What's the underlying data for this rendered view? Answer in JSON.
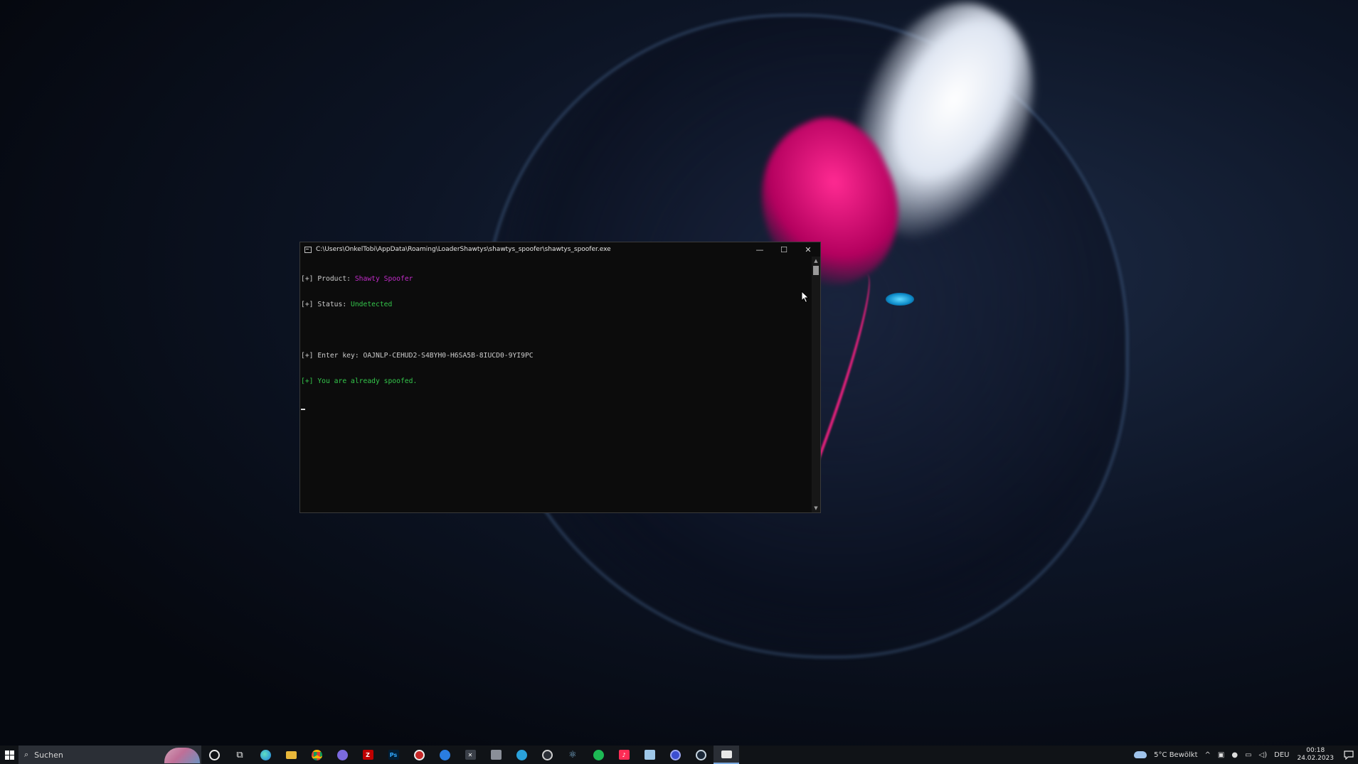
{
  "console": {
    "title": "C:\\Users\\OnkelTobi\\AppData\\Roaming\\LoaderShawtys\\shawtys_spoofer\\shawtys_spoofer.exe",
    "lines": {
      "product_prefix": "[+] Product: ",
      "product_value": "Shawty Spoofer",
      "status_prefix": "[+] Status: ",
      "status_value": "Undetected",
      "key_line": "[+] Enter key: OAJNLP-CEHUD2-S4BYH0-H6SA5B-8IUCD0-9YI9PC",
      "spoofed_line": "[+] You are already spoofed."
    },
    "colors": {
      "product": "#c22cc9",
      "status": "#34c64b",
      "spoofed": "#34c64b"
    },
    "buttons": {
      "minimize": "—",
      "maximize": "☐",
      "close": "✕"
    }
  },
  "taskbar": {
    "search_placeholder": "Suchen",
    "weather": "5°C  Bewölkt",
    "language": "DEU",
    "time": "00:18",
    "date": "24.02.2023",
    "apps": [
      "cortana-icon",
      "task-view-icon",
      "edge-icon",
      "file-explorer-icon",
      "chrome-icon",
      "discord-icon",
      "filezilla-icon",
      "photoshop-icon",
      "app-red-icon",
      "app-blue-icon",
      "app-kraken-icon",
      "app-gray-icon",
      "telegram-icon",
      "app-clock-icon",
      "atom-icon",
      "spotify-icon",
      "tiktok-icon",
      "notepad-icon",
      "app-globe-icon",
      "steam-icon",
      "console-app-icon"
    ]
  }
}
